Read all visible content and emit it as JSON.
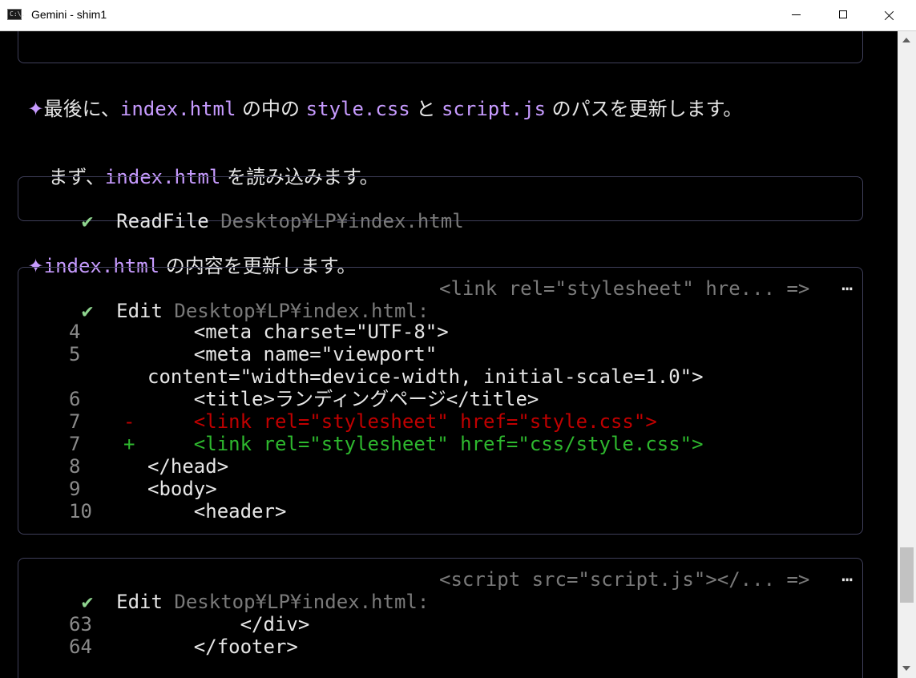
{
  "window": {
    "title": "Gemini - shim1",
    "icon_text": "C:\\."
  },
  "messages": {
    "line1": {
      "bullet": "✦",
      "p1": "最後に、",
      "f1": "index.html",
      "p2": " の中の ",
      "f2": "style.css",
      "p3": " と ",
      "f3": "script.js",
      "p4": " のパスを更新します。"
    },
    "line2": {
      "p1": "まず、",
      "f1": "index.html",
      "p2": " を読み込みます。"
    },
    "line3": {
      "bullet": "✦",
      "f1": "index.html",
      "p1": " の内容を更新します。"
    }
  },
  "tools": {
    "readfile": {
      "icon": "✔",
      "name": "ReadFile",
      "path": "Desktop¥LP¥index.html"
    },
    "edit1": {
      "icon": "✔",
      "name": "Edit",
      "path": "Desktop¥LP¥index.html:",
      "summary": "<link rel=\"stylesheet\" hre... =>",
      "more": "⋯",
      "lines": [
        {
          "num": "4",
          "sign": "",
          "text": "    <meta charset=\"UTF-8\">"
        },
        {
          "num": "5",
          "sign": "",
          "text": "    <meta name=\"viewport\""
        },
        {
          "num": "",
          "sign": "",
          "text": "content=\"width=device-width, initial-scale=1.0\">"
        },
        {
          "num": "6",
          "sign": "",
          "text": "    <title>ランディングページ</title>"
        },
        {
          "num": "7",
          "sign": "-",
          "text": "    <link rel=\"stylesheet\" href=\"style.css\">"
        },
        {
          "num": "7",
          "sign": "+",
          "text": "    <link rel=\"stylesheet\" href=\"css/style.css\">"
        },
        {
          "num": "8",
          "sign": "",
          "text": "</head>"
        },
        {
          "num": "9",
          "sign": "",
          "text": "<body>"
        },
        {
          "num": "10",
          "sign": "",
          "text": "    <header>"
        }
      ]
    },
    "edit2": {
      "icon": "✔",
      "name": "Edit",
      "path": "Desktop¥LP¥index.html:",
      "summary": "<script src=\"script.js\"></... =>",
      "more": "⋯",
      "lines": [
        {
          "num": "63",
          "sign": "",
          "text": "        </div>"
        },
        {
          "num": "64",
          "sign": "",
          "text": "    </footer>"
        }
      ]
    }
  }
}
